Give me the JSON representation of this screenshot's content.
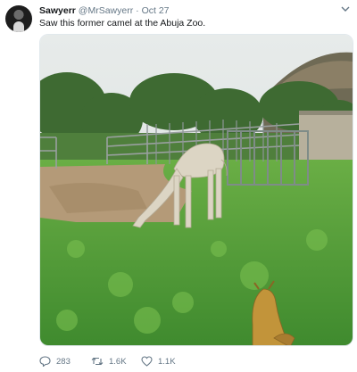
{
  "tweet": {
    "author_name": "Sawyerr",
    "handle": "@MrSawyerr",
    "separator": "·",
    "date": "Oct 27",
    "text": "Saw this former camel at the Abuja Zoo.",
    "menu_icon": "chevron-down-icon",
    "avatar_icon": "avatar"
  },
  "media": {
    "description_icon": "photo",
    "colors": {
      "sky": "#e8ecec",
      "grass": "#5aa43a",
      "dirt": "#b49a78",
      "tree": "#3e6a32"
    }
  },
  "actions": {
    "reply_count": "283",
    "retweet_count": "1.6K",
    "like_count": "1.1K",
    "reply_icon": "reply-icon",
    "retweet_icon": "retweet-icon",
    "like_icon": "heart-icon"
  }
}
